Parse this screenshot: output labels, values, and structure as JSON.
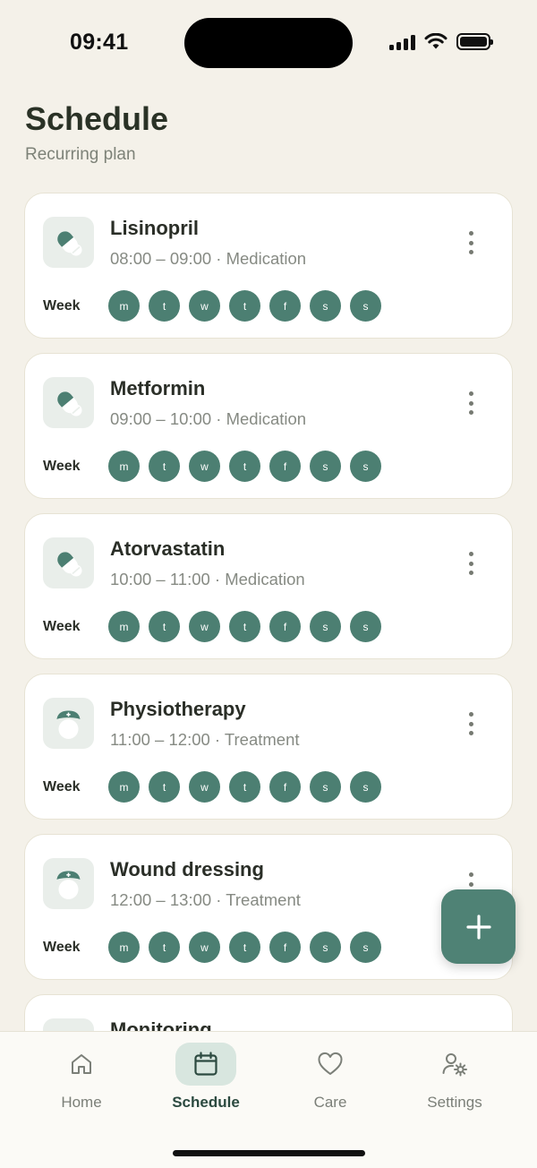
{
  "status_bar": {
    "time": "09:41"
  },
  "header": {
    "title": "Schedule",
    "subtitle": "Recurring plan"
  },
  "week_label": "Week",
  "days": [
    "m",
    "t",
    "w",
    "t",
    "f",
    "s",
    "s"
  ],
  "cards": [
    {
      "title": "Lisinopril",
      "subtitle": "08:00 – 09:00 · Medication",
      "icon": "pill-icon"
    },
    {
      "title": "Metformin",
      "subtitle": "09:00 – 10:00 · Medication",
      "icon": "pill-icon"
    },
    {
      "title": "Atorvastatin",
      "subtitle": "10:00 – 11:00 · Medication",
      "icon": "pill-icon"
    },
    {
      "title": "Physiotherapy",
      "subtitle": "11:00 – 12:00 · Treatment",
      "icon": "nurse-icon"
    },
    {
      "title": "Wound dressing",
      "subtitle": "12:00 – 13:00 · Treatment",
      "icon": "nurse-icon"
    },
    {
      "title": "Monitoring",
      "subtitle": "",
      "icon": "nurse-icon"
    }
  ],
  "fab": {
    "icon": "plus-icon"
  },
  "tabs": [
    {
      "label": "Home",
      "icon": "home-icon",
      "active": false
    },
    {
      "label": "Schedule",
      "icon": "calendar-icon",
      "active": true
    },
    {
      "label": "Care",
      "icon": "heart-icon",
      "active": false
    },
    {
      "label": "Settings",
      "icon": "user-settings-icon",
      "active": false
    }
  ],
  "colors": {
    "accent": "#4c7f72",
    "background": "#f4f1e9",
    "card": "#ffffff",
    "active_tab_bg": "#d8e6df"
  }
}
